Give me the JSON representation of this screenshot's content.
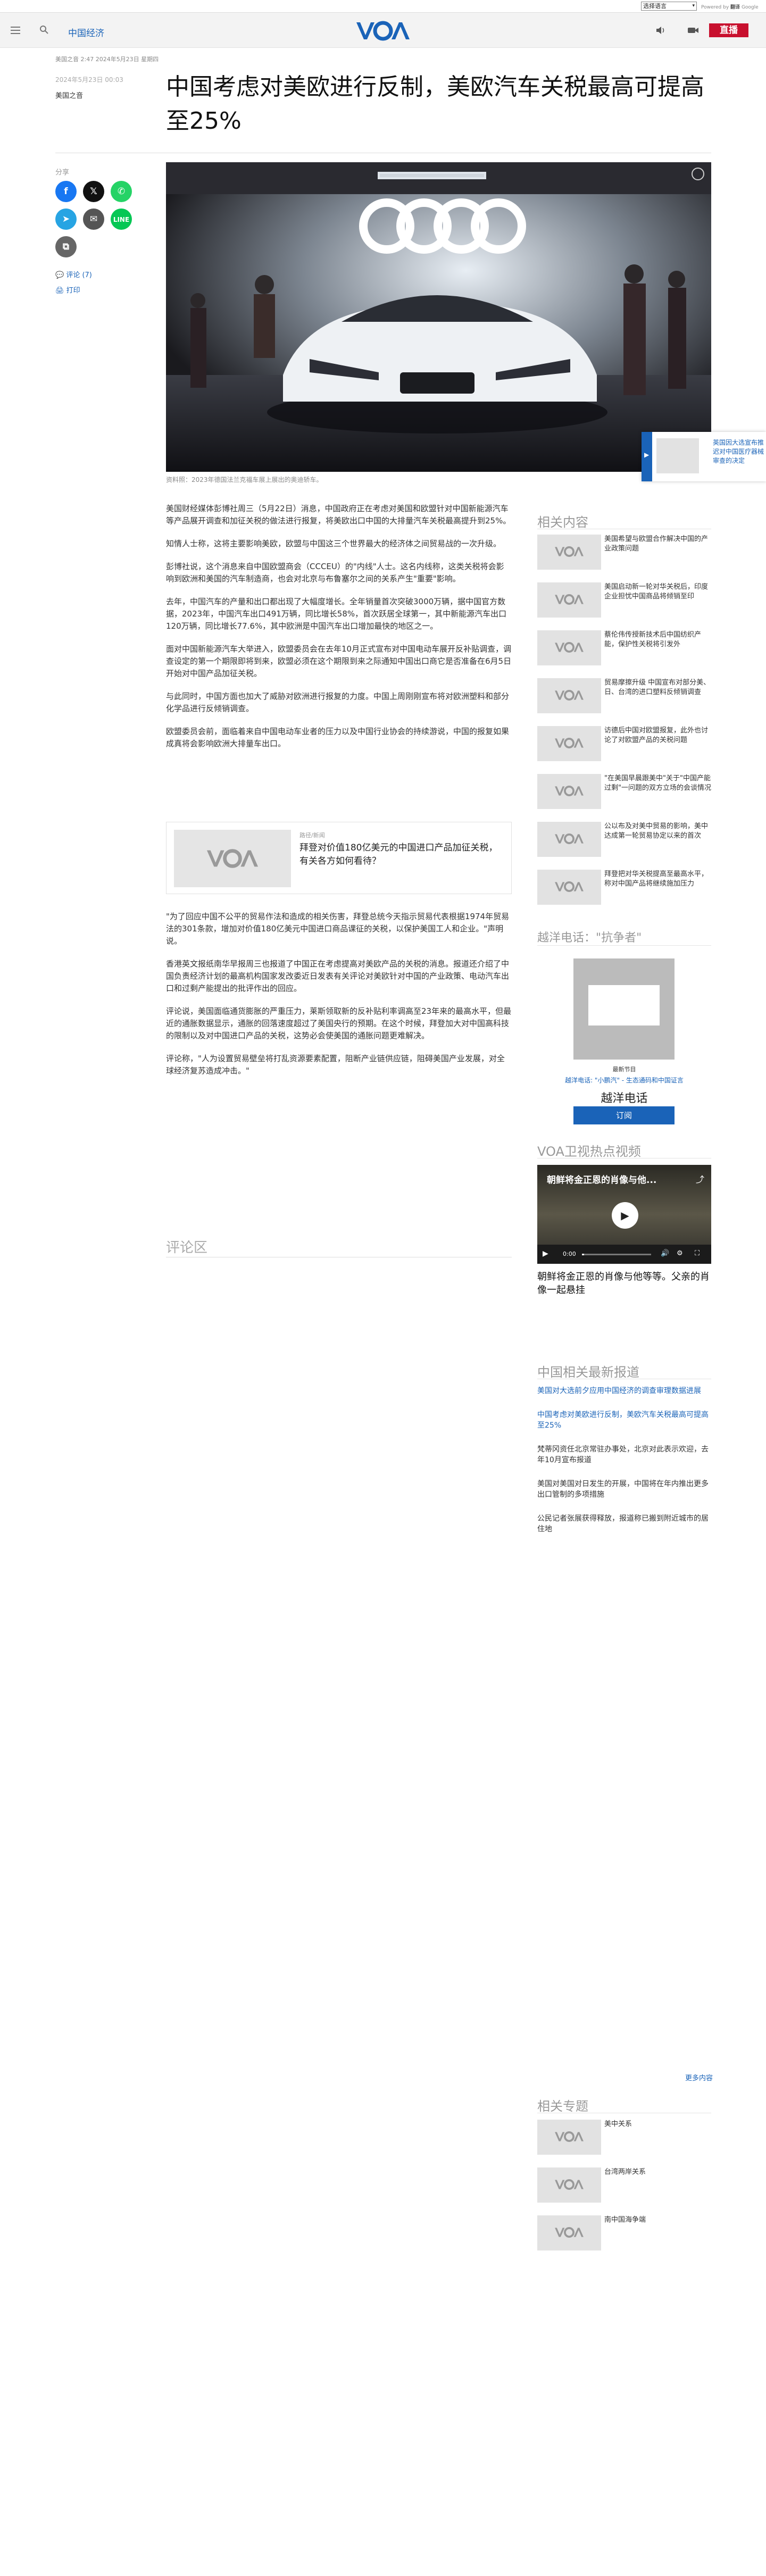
{
  "topbar": {
    "language_select": "选择语言",
    "gt_prefix": "Powered by",
    "gt_brand": "翻译",
    "gt_suffix": "Google"
  },
  "nav": {
    "section_link": "中国经济",
    "live_label": "直播"
  },
  "article": {
    "meta": "美国之音 2:47 2024年5月23日 星期四",
    "published": "2024年5月23日 00:03",
    "category": "美国之音",
    "title": "中国考虑对美欧进行反制，美欧汽车关税最高可提高至25%",
    "share_label": "分享",
    "comments_link": "评论 (7)",
    "print_link": "打印",
    "caption": "资料照：2023年德国法兰克福车展上展出的奥迪轿车。",
    "paragraphs": [
      "美国财经媒体彭博社周三（5月22日）消息，中国政府正在考虑对美国和欧盟针对中国新能源汽车等产品展开调查和加征关税的做法进行报复，将美欧出口中国的大排量汽车关税最高提升到25%。",
      "知情人士称，这将主要影响美欧，欧盟与中国这三个世界最大的经济体之间贸易战的一次升级。",
      "彭博社说，这个消息来自中国欧盟商会（CCCEU）的\"内线\"人士。这名内线称，这类关税将会影响到欧洲和美国的汽车制造商，也会对北京与布鲁塞尔之间的关系产生\"重要\"影响。",
      "去年，中国汽车的产量和出口都出现了大幅度增长。全年销量首次突破3000万辆，据中国官方数据，2023年，中国汽车出口491万辆，同比增长58%，首次跃居全球第一，其中新能源汽车出口120万辆，同比增长77.6%，其中欧洲是中国汽车出口增加最快的地区之一。",
      "面对中国新能源汽车大举进入，欧盟委员会在去年10月正式宣布对中国电动车展开反补贴调查，调查设定的第一个期限即将到来，欧盟必须在这个期限到来之际通知中国出口商它是否准备在6月5日开始对中国产品加征关税。",
      "与此同时，中国方面也加大了威胁对欧洲进行报复的力度。中国上周刚刚宣布将对欧洲塑料和部分化学品进行反倾销调查。",
      "欧盟委员会前，面临着来自中国电动车业者的压力以及中国行业协会的持续游说，中国的报复如果成真将会影响欧洲大排量车出口。",
      "\"为了回应中国不公平的贸易作法和造成的相关伤害，拜登总统今天指示贸易代表根据1974年贸易法的301条款，增加对价值180亿美元中国进口商品课征的关税，以保护美国工人和企业。\"声明说。",
      "香港英文报纸南华早报周三也报道了中国正在考虑提高对美欧产品的关税的消息。报道还介绍了中国负责经济计划的最高机构国家发改委近日发表有关评论对美欧针对中国的产业政策、电动汽车出口和过剩产能提出的批评作出的回应。",
      "评论说，美国面临通货膨胀的严重压力，莱斯领取新的反补贴利率调高至23年来的最高水平，但最近的通胀数据显示，通胀的回落速度超过了美国央行的预期。在这个时候，拜登加大对中国高科技的限制以及对中国进口产品的关税，这势必会使美国的通胀问题更难解决。",
      "评论称，\"人为设置贸易壁垒将打乱资源要素配置，阻断产业链供应链，阻碍美国产业发展，对全球经济复苏造成冲击。\""
    ],
    "related_card": {
      "label": "路径/新闻",
      "title": "拜登对价值180亿美元的中国进口产品加征关税，有关各方如何看待？"
    },
    "comments_heading": "评论区"
  },
  "sidebar": {
    "related_title": "相关内容",
    "related": [
      "美国希望与欧盟合作解决中国的产业政策问题",
      "美国启动新一轮对华关税后，印度企业担忧中国商品将倾销至印",
      "蔡伦伟传授新技术后中国纺织产能，保护性关税将引发外",
      "贸易摩擦升级 中国宣布对部分美、日、台湾的进口塑料反倾销调查",
      "访德后中国对欧盟报复，此外也讨论了对欧盟产品的关税问题",
      "\"在美国早晨跟美中\"关于\"中国产能过剩\"一问题的双方立场的会谈情况",
      "公以布及对美中贸易的影响，美中达成第一轮贸易协定以来的首次",
      "拜登把对华关税提高至最高水平，称对中国产品将继续施加压力"
    ],
    "radio_title": "越洋电话：\"抗争者\"",
    "radio_latest": "最新节目",
    "radio_ep": "越洋电话: \"小鹏汽\" - 生态通码和中国证言",
    "radio_name": "越洋电话",
    "subscribe": "订阅",
    "video_title": "VOA卫视热点视频",
    "video_overlay": "朝鲜将金正恩的肖像与他...",
    "video_time": "0:00",
    "video_caption": "朝鲜将金正恩的肖像与他等等。父亲的肖像一起悬挂",
    "news_title": "中国相关最新报道",
    "news": [
      "美国对大选前夕应用中国经济的调查审理数据进展",
      "中国考虑对美欧进行反制，美欧汽车关税最高可提高至25%",
      "梵蒂冈资任北京常驻办事处，北京对此表示欢迎，去年10月宣布报道",
      "美国对美国对日发生的开展，中国将在年内推出更多出口管制的多项措施",
      "公民记者张展获得释放，报道称已搬到附近城市的居住地"
    ],
    "more": "更多内容",
    "topics_title": "相关专题",
    "topics": [
      "美中关系",
      "台湾两岸关系",
      "南中国海争端"
    ]
  },
  "floater": {
    "text": "英国因大选宣布推迟对中国医疗器械审查的决定"
  },
  "colors": {
    "accent": "#1a63b8",
    "live": "#c8102e",
    "subscribe": "#1a63b8"
  }
}
